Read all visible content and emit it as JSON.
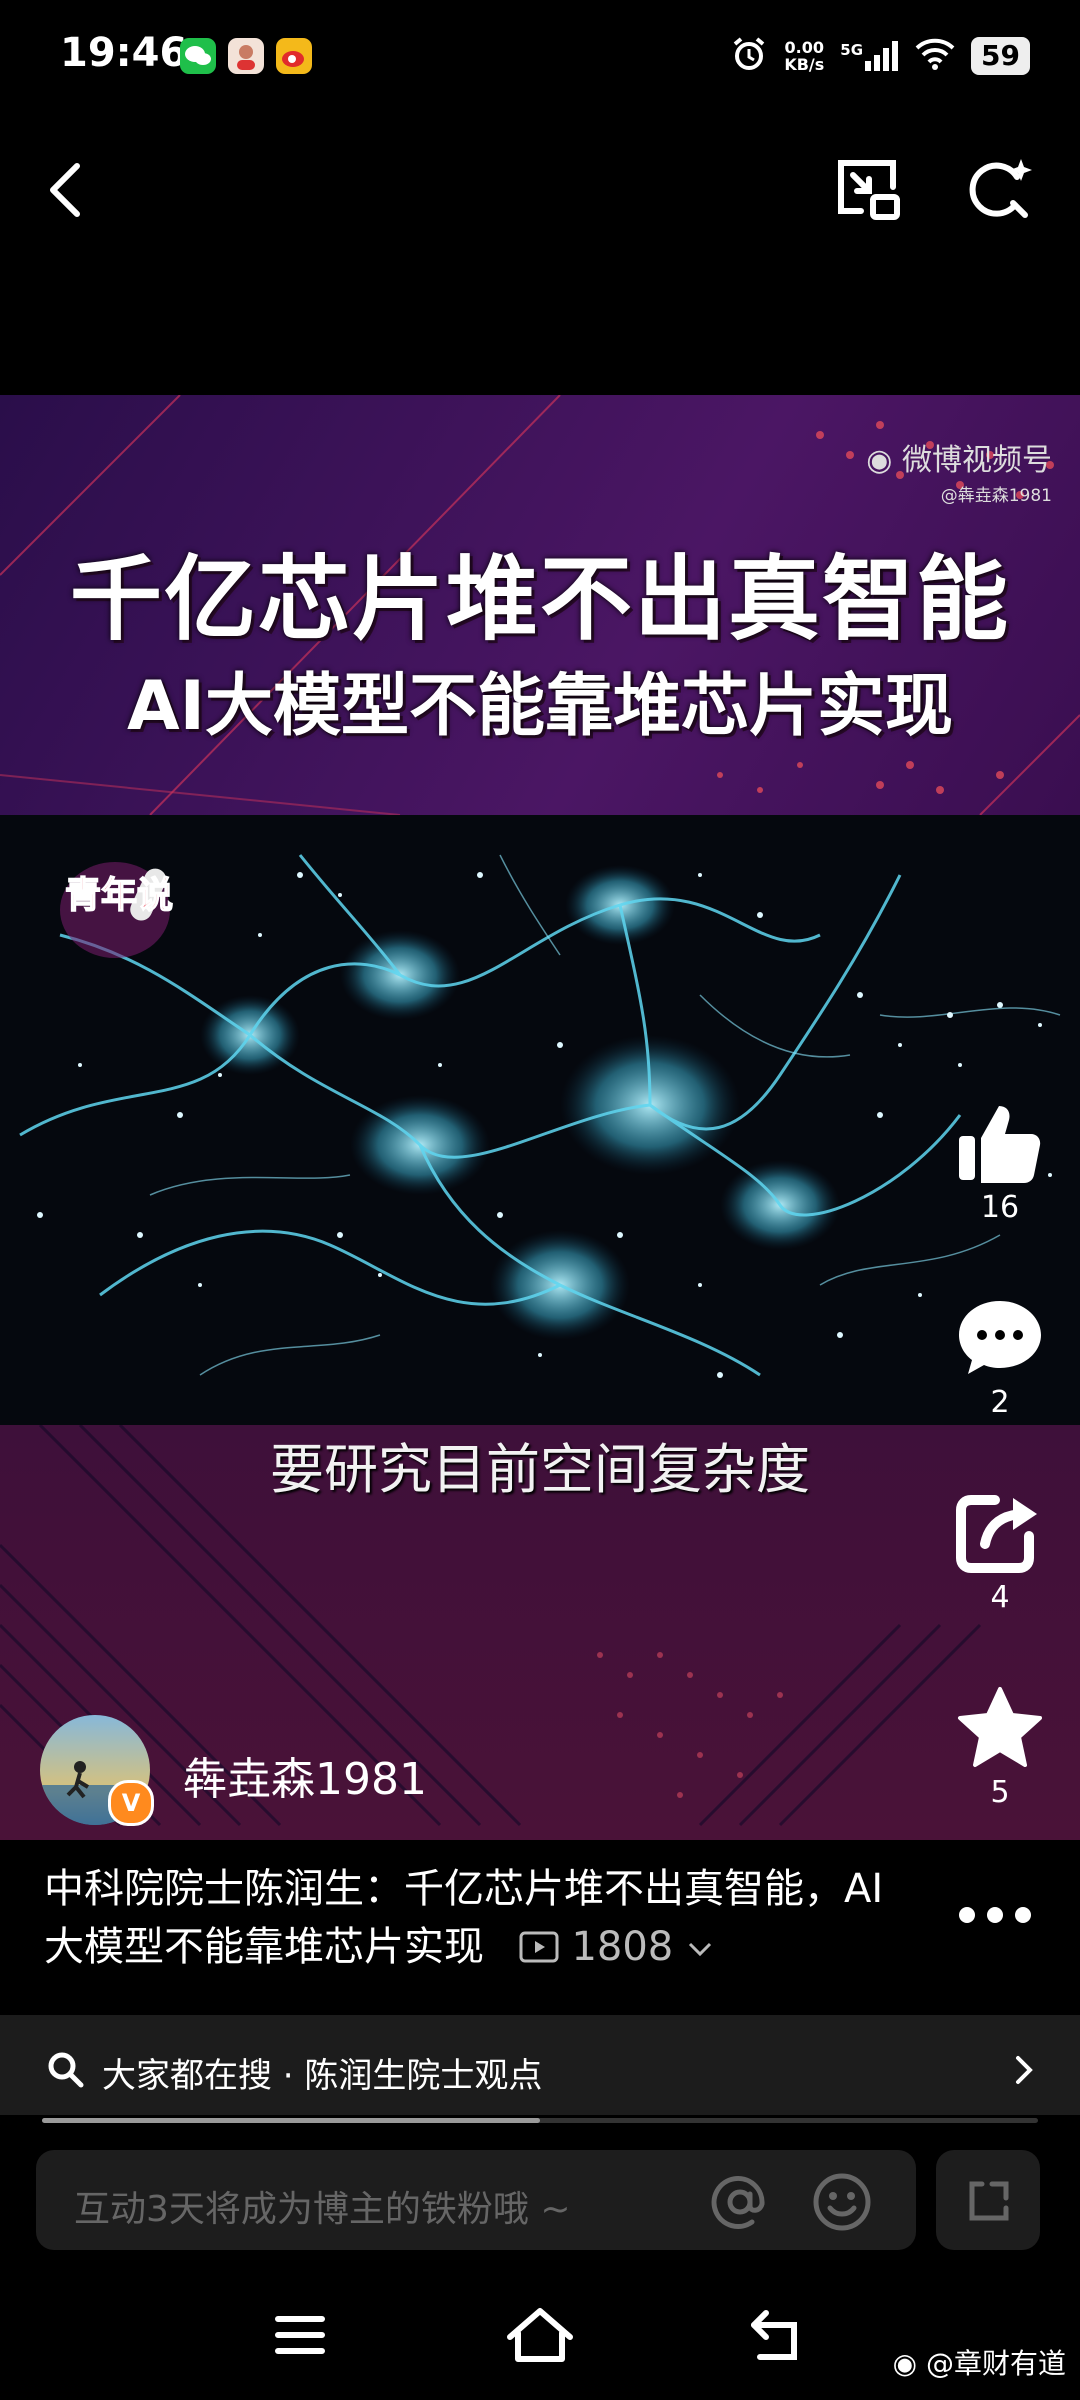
{
  "status_bar": {
    "time": "19:46",
    "net_speed_value": "0.00",
    "net_speed_unit": "KB/s",
    "signal": "5G",
    "battery": "59"
  },
  "video": {
    "title_line1": "千亿芯片堆不出真智能",
    "title_line2": "AI大模型不能靠堆芯片实现",
    "watermark_brand": "微博视频号",
    "watermark_handle": "@犇垚森1981",
    "program_logo_text": "青年说",
    "subtitle": "要研究目前空间复杂度"
  },
  "actions": {
    "likes": "16",
    "comments": "2",
    "shares": "4",
    "favorites": "5"
  },
  "author": {
    "name": "犇垚森1981"
  },
  "description": {
    "text": "中科院院士陈润生：千亿芯片堆不出真智能，AI大模型不能靠堆芯片实现",
    "views": "1808"
  },
  "search_suggestion": {
    "text": "大家都在搜 · 陈润生院士观点"
  },
  "progress": {
    "fraction": 0.5
  },
  "comment_input": {
    "placeholder": "互动3天将成为博主的铁粉哦 ~"
  },
  "corner_watermark": "@章财有道"
}
